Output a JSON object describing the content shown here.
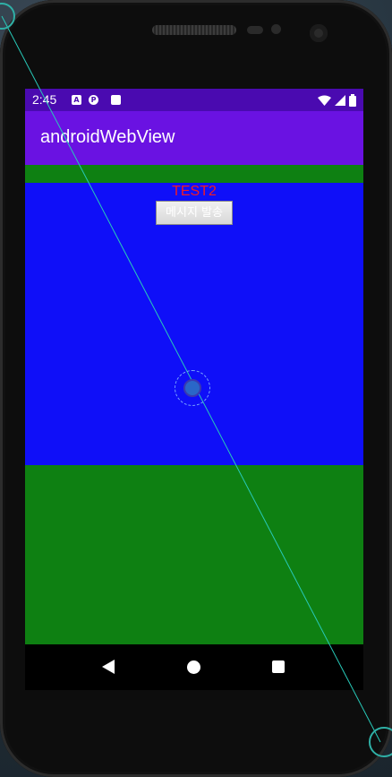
{
  "status_bar": {
    "time": "2:45",
    "notification_icons": [
      "a-icon",
      "p-icon",
      "sd-card-icon"
    ],
    "system_icons": [
      "wifi-icon",
      "signal-icon",
      "battery-icon"
    ]
  },
  "app_bar": {
    "title": "androidWebView"
  },
  "webview": {
    "label": "TEST2",
    "button_label": "메시지 발송"
  },
  "nav_bar": {
    "icons": [
      "back-icon",
      "home-icon",
      "recents-icon"
    ]
  },
  "colors": {
    "status_bar": "#4a0ab0",
    "app_bar": "#6a12e2",
    "page_background": "#0e8012",
    "div_background": "#0f0ff8",
    "label_text": "#f01b25"
  }
}
